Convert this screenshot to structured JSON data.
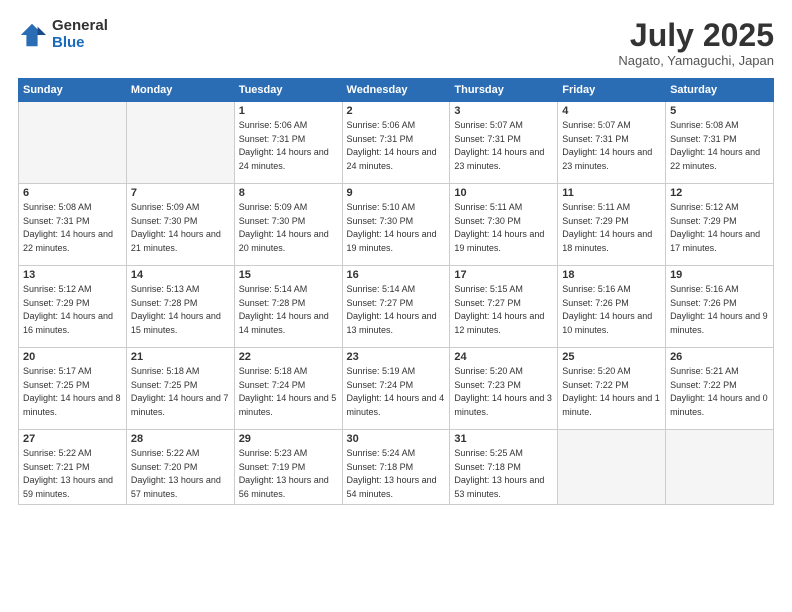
{
  "logo": {
    "general": "General",
    "blue": "Blue"
  },
  "title": "July 2025",
  "location": "Nagato, Yamaguchi, Japan",
  "headers": [
    "Sunday",
    "Monday",
    "Tuesday",
    "Wednesday",
    "Thursday",
    "Friday",
    "Saturday"
  ],
  "weeks": [
    [
      {
        "day": "",
        "empty": true
      },
      {
        "day": "",
        "empty": true
      },
      {
        "day": "1",
        "sunrise": "Sunrise: 5:06 AM",
        "sunset": "Sunset: 7:31 PM",
        "daylight": "Daylight: 14 hours and 24 minutes."
      },
      {
        "day": "2",
        "sunrise": "Sunrise: 5:06 AM",
        "sunset": "Sunset: 7:31 PM",
        "daylight": "Daylight: 14 hours and 24 minutes."
      },
      {
        "day": "3",
        "sunrise": "Sunrise: 5:07 AM",
        "sunset": "Sunset: 7:31 PM",
        "daylight": "Daylight: 14 hours and 23 minutes."
      },
      {
        "day": "4",
        "sunrise": "Sunrise: 5:07 AM",
        "sunset": "Sunset: 7:31 PM",
        "daylight": "Daylight: 14 hours and 23 minutes."
      },
      {
        "day": "5",
        "sunrise": "Sunrise: 5:08 AM",
        "sunset": "Sunset: 7:31 PM",
        "daylight": "Daylight: 14 hours and 22 minutes."
      }
    ],
    [
      {
        "day": "6",
        "sunrise": "Sunrise: 5:08 AM",
        "sunset": "Sunset: 7:31 PM",
        "daylight": "Daylight: 14 hours and 22 minutes."
      },
      {
        "day": "7",
        "sunrise": "Sunrise: 5:09 AM",
        "sunset": "Sunset: 7:30 PM",
        "daylight": "Daylight: 14 hours and 21 minutes."
      },
      {
        "day": "8",
        "sunrise": "Sunrise: 5:09 AM",
        "sunset": "Sunset: 7:30 PM",
        "daylight": "Daylight: 14 hours and 20 minutes."
      },
      {
        "day": "9",
        "sunrise": "Sunrise: 5:10 AM",
        "sunset": "Sunset: 7:30 PM",
        "daylight": "Daylight: 14 hours and 19 minutes."
      },
      {
        "day": "10",
        "sunrise": "Sunrise: 5:11 AM",
        "sunset": "Sunset: 7:30 PM",
        "daylight": "Daylight: 14 hours and 19 minutes."
      },
      {
        "day": "11",
        "sunrise": "Sunrise: 5:11 AM",
        "sunset": "Sunset: 7:29 PM",
        "daylight": "Daylight: 14 hours and 18 minutes."
      },
      {
        "day": "12",
        "sunrise": "Sunrise: 5:12 AM",
        "sunset": "Sunset: 7:29 PM",
        "daylight": "Daylight: 14 hours and 17 minutes."
      }
    ],
    [
      {
        "day": "13",
        "sunrise": "Sunrise: 5:12 AM",
        "sunset": "Sunset: 7:29 PM",
        "daylight": "Daylight: 14 hours and 16 minutes."
      },
      {
        "day": "14",
        "sunrise": "Sunrise: 5:13 AM",
        "sunset": "Sunset: 7:28 PM",
        "daylight": "Daylight: 14 hours and 15 minutes."
      },
      {
        "day": "15",
        "sunrise": "Sunrise: 5:14 AM",
        "sunset": "Sunset: 7:28 PM",
        "daylight": "Daylight: 14 hours and 14 minutes."
      },
      {
        "day": "16",
        "sunrise": "Sunrise: 5:14 AM",
        "sunset": "Sunset: 7:27 PM",
        "daylight": "Daylight: 14 hours and 13 minutes."
      },
      {
        "day": "17",
        "sunrise": "Sunrise: 5:15 AM",
        "sunset": "Sunset: 7:27 PM",
        "daylight": "Daylight: 14 hours and 12 minutes."
      },
      {
        "day": "18",
        "sunrise": "Sunrise: 5:16 AM",
        "sunset": "Sunset: 7:26 PM",
        "daylight": "Daylight: 14 hours and 10 minutes."
      },
      {
        "day": "19",
        "sunrise": "Sunrise: 5:16 AM",
        "sunset": "Sunset: 7:26 PM",
        "daylight": "Daylight: 14 hours and 9 minutes."
      }
    ],
    [
      {
        "day": "20",
        "sunrise": "Sunrise: 5:17 AM",
        "sunset": "Sunset: 7:25 PM",
        "daylight": "Daylight: 14 hours and 8 minutes."
      },
      {
        "day": "21",
        "sunrise": "Sunrise: 5:18 AM",
        "sunset": "Sunset: 7:25 PM",
        "daylight": "Daylight: 14 hours and 7 minutes."
      },
      {
        "day": "22",
        "sunrise": "Sunrise: 5:18 AM",
        "sunset": "Sunset: 7:24 PM",
        "daylight": "Daylight: 14 hours and 5 minutes."
      },
      {
        "day": "23",
        "sunrise": "Sunrise: 5:19 AM",
        "sunset": "Sunset: 7:24 PM",
        "daylight": "Daylight: 14 hours and 4 minutes."
      },
      {
        "day": "24",
        "sunrise": "Sunrise: 5:20 AM",
        "sunset": "Sunset: 7:23 PM",
        "daylight": "Daylight: 14 hours and 3 minutes."
      },
      {
        "day": "25",
        "sunrise": "Sunrise: 5:20 AM",
        "sunset": "Sunset: 7:22 PM",
        "daylight": "Daylight: 14 hours and 1 minute."
      },
      {
        "day": "26",
        "sunrise": "Sunrise: 5:21 AM",
        "sunset": "Sunset: 7:22 PM",
        "daylight": "Daylight: 14 hours and 0 minutes."
      }
    ],
    [
      {
        "day": "27",
        "sunrise": "Sunrise: 5:22 AM",
        "sunset": "Sunset: 7:21 PM",
        "daylight": "Daylight: 13 hours and 59 minutes."
      },
      {
        "day": "28",
        "sunrise": "Sunrise: 5:22 AM",
        "sunset": "Sunset: 7:20 PM",
        "daylight": "Daylight: 13 hours and 57 minutes."
      },
      {
        "day": "29",
        "sunrise": "Sunrise: 5:23 AM",
        "sunset": "Sunset: 7:19 PM",
        "daylight": "Daylight: 13 hours and 56 minutes."
      },
      {
        "day": "30",
        "sunrise": "Sunrise: 5:24 AM",
        "sunset": "Sunset: 7:18 PM",
        "daylight": "Daylight: 13 hours and 54 minutes."
      },
      {
        "day": "31",
        "sunrise": "Sunrise: 5:25 AM",
        "sunset": "Sunset: 7:18 PM",
        "daylight": "Daylight: 13 hours and 53 minutes."
      },
      {
        "day": "",
        "empty": true
      },
      {
        "day": "",
        "empty": true
      }
    ]
  ]
}
